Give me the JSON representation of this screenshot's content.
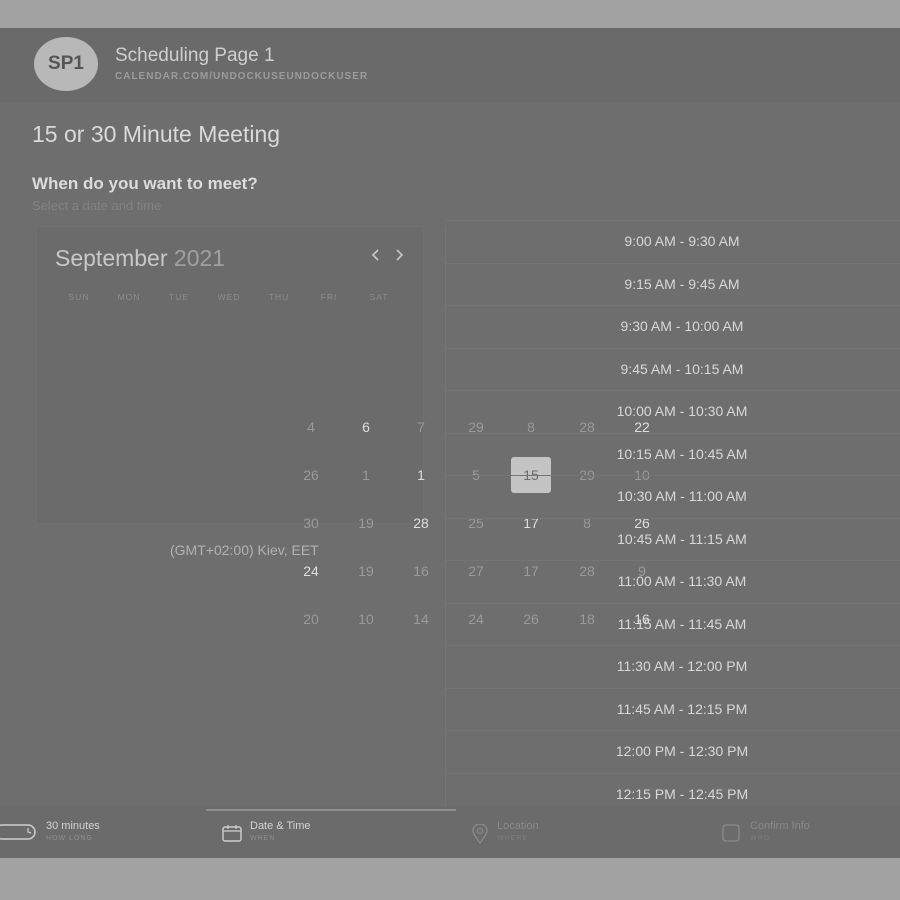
{
  "header": {
    "avatar": "SP1",
    "title": "Scheduling Page 1",
    "url": "CALENDAR.COM/UNDOCKUSEUNDOCKUSER"
  },
  "meeting_title": "15 or 30 Minute Meeting",
  "prompt": {
    "question": "When do you want to meet?",
    "hint": "Select a date and time"
  },
  "calendar": {
    "month": "September",
    "year": "2021",
    "weekdays": [
      "SUN",
      "MON",
      "TUE",
      "WED",
      "THU",
      "FRI",
      "SAT"
    ],
    "prev_icon": "chevron-left-icon",
    "next_icon": "chevron-right-icon",
    "selected_day": "15",
    "cells": [
      "4",
      "6",
      "7",
      "29",
      "8",
      "28",
      "22",
      "26",
      "1",
      "1",
      "5",
      "15",
      "29",
      "10",
      "30",
      "19",
      "28",
      "25",
      "17",
      "8",
      "26",
      "24",
      "19",
      "16",
      "27",
      "17",
      "28",
      "9",
      "20",
      "10",
      "14",
      "24",
      "26",
      "18",
      "16"
    ]
  },
  "timezone": "(GMT+02:00) Kiev, EET",
  "time_slots": [
    "9:00 AM - 9:30 AM",
    "9:15 AM - 9:45 AM",
    "9:30 AM - 10:00 AM",
    "9:45 AM - 10:15 AM",
    "10:00 AM - 10:30 AM",
    "10:15 AM - 10:45 AM",
    "10:30 AM - 11:00 AM",
    "10:45 AM - 11:15 AM",
    "11:00 AM - 11:30 AM",
    "11:15 AM - 11:45 AM",
    "11:30 AM - 12:00 PM",
    "11:45 AM - 12:15 PM",
    "12:00 PM - 12:30 PM",
    "12:15 PM - 12:45 PM"
  ],
  "footer": {
    "duration": {
      "title": "30 minutes",
      "sub": "HOW LONG",
      "icon": "clock-icon"
    },
    "datetime": {
      "title": "Date & Time",
      "sub": "WHEN",
      "icon": "calendar-icon"
    },
    "location": {
      "title": "Location",
      "sub": "WHERE",
      "icon": "map-pin-icon"
    },
    "confirm": {
      "title": "Confirm Info",
      "sub": "WHO",
      "icon": "checkbox-icon"
    }
  },
  "colors": {
    "overlay": "#6e6e6e",
    "selected_day": "#c4c4c4",
    "outer": "#a2a2a2"
  }
}
